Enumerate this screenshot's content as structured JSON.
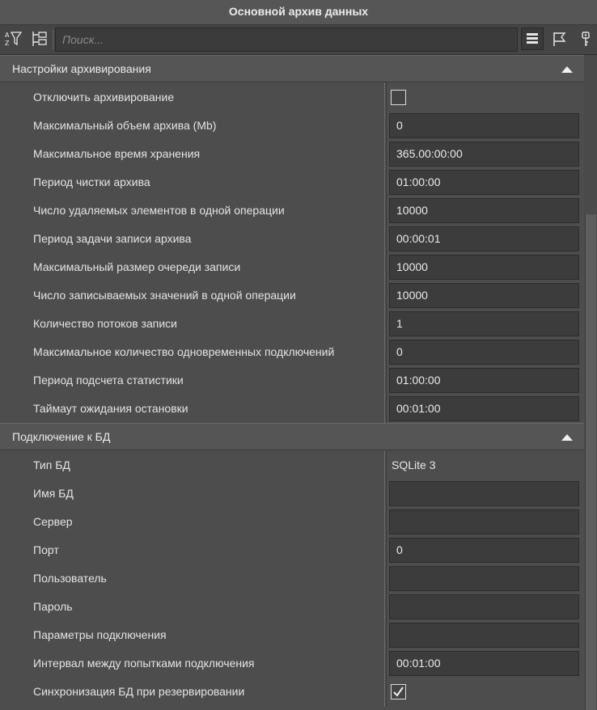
{
  "window": {
    "title": "Основной архив данных"
  },
  "toolbar": {
    "search_placeholder": "Поиск...",
    "icons": [
      "sort-az-filter-icon",
      "category-view-icon",
      "list-view-icon",
      "flag-icon",
      "key-icon"
    ]
  },
  "sections": [
    {
      "title": "Настройки архивирования",
      "rows": [
        {
          "label": "Отключить архивирование",
          "type": "checkbox",
          "checked": false
        },
        {
          "label": "Максимальный объем архива (Mb)",
          "type": "field",
          "value": "0"
        },
        {
          "label": "Максимальное время хранения",
          "type": "field",
          "value": "365.00:00:00"
        },
        {
          "label": "Период чистки архива",
          "type": "field",
          "value": "01:00:00"
        },
        {
          "label": "Число удаляемых элементов в одной операции",
          "type": "field",
          "value": "10000"
        },
        {
          "label": "Период задачи записи архива",
          "type": "field",
          "value": "00:00:01"
        },
        {
          "label": "Максимальный размер очереди записи",
          "type": "field",
          "value": "10000"
        },
        {
          "label": "Число записываемых значений в одной операции",
          "type": "field",
          "value": "10000"
        },
        {
          "label": "Количество потоков записи",
          "type": "field",
          "value": "1"
        },
        {
          "label": "Максимальное количество одновременных подключений",
          "type": "field",
          "value": "0"
        },
        {
          "label": "Период подсчета статистики",
          "type": "field",
          "value": "01:00:00"
        },
        {
          "label": "Таймаут ожидания остановки",
          "type": "field",
          "value": "00:01:00"
        }
      ]
    },
    {
      "title": "Подключение к БД",
      "rows": [
        {
          "label": "Тип БД",
          "type": "text",
          "value": "SQLite 3"
        },
        {
          "label": "Имя БД",
          "type": "field",
          "value": ""
        },
        {
          "label": "Сервер",
          "type": "field",
          "value": ""
        },
        {
          "label": "Порт",
          "type": "field",
          "value": "0"
        },
        {
          "label": "Пользователь",
          "type": "field",
          "value": ""
        },
        {
          "label": "Пароль",
          "type": "field",
          "value": ""
        },
        {
          "label": "Параметры подключения",
          "type": "field",
          "value": ""
        },
        {
          "label": "Интервал между попытками подключения",
          "type": "field",
          "value": "00:01:00"
        },
        {
          "label": "Синхронизация БД при резервировании",
          "type": "checkbox",
          "checked": true
        }
      ]
    }
  ]
}
